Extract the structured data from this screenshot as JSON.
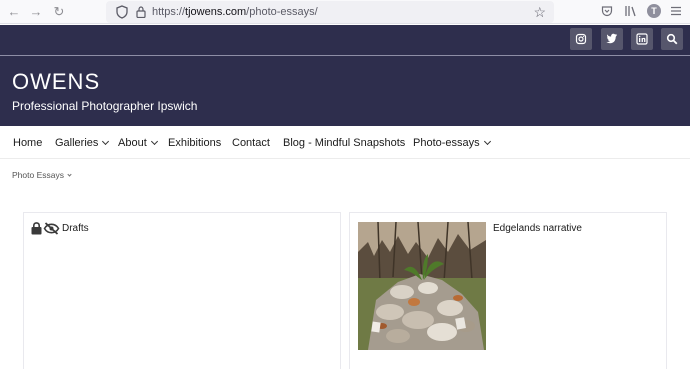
{
  "browser": {
    "url_prefix": "https://",
    "url_host": "tjowens.com",
    "url_path": "/photo-essays/",
    "profile_initial": "T"
  },
  "social": [
    "instagram-icon",
    "twitter-icon",
    "linkedin-icon",
    "search-icon"
  ],
  "site": {
    "title": "OWENS",
    "tagline": "Professional Photographer Ipswich"
  },
  "nav": {
    "items": [
      {
        "label": "Home",
        "dropdown": false
      },
      {
        "label": "Galleries",
        "dropdown": true
      },
      {
        "label": "About",
        "dropdown": true
      },
      {
        "label": "Exhibitions",
        "dropdown": false
      },
      {
        "label": "Contact",
        "dropdown": false
      },
      {
        "label": "Blog - Mindful Snapshots",
        "dropdown": false
      },
      {
        "label": "Photo-essays",
        "dropdown": true
      }
    ]
  },
  "breadcrumb": {
    "label": "Photo Essays"
  },
  "cards": [
    {
      "title": "Drafts",
      "icons": [
        "lock-icon",
        "eye-slash-icon"
      ]
    },
    {
      "title": "Edgelands narrative",
      "image": "rock-pile-photo"
    }
  ],
  "colors": {
    "header_bg": "#2e2e4d",
    "social_bg": "#56566c",
    "text": "#1b1b1b"
  }
}
